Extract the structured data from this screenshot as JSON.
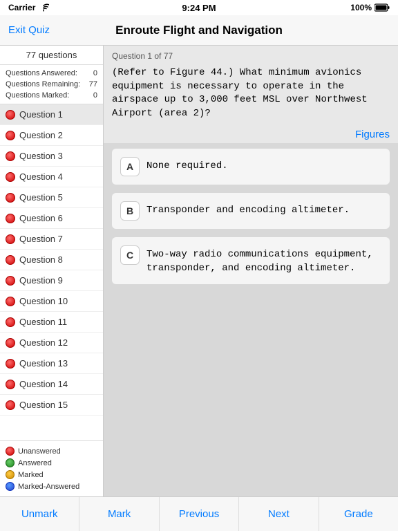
{
  "statusBar": {
    "carrier": "Carrier",
    "time": "9:24 PM",
    "battery": "100%"
  },
  "header": {
    "exitLabel": "Exit Quiz",
    "title": "Enroute Flight and Navigation"
  },
  "sidebar": {
    "countLabel": "77 questions",
    "stats": [
      {
        "label": "Questions Answered:",
        "value": "0"
      },
      {
        "label": "Questions Remaining:",
        "value": "77"
      },
      {
        "label": "Questions Marked:",
        "value": "0"
      }
    ],
    "questions": [
      {
        "id": 1,
        "label": "Question 1",
        "status": "unanswered",
        "active": true
      },
      {
        "id": 2,
        "label": "Question 2",
        "status": "unanswered",
        "active": false
      },
      {
        "id": 3,
        "label": "Question 3",
        "status": "unanswered",
        "active": false
      },
      {
        "id": 4,
        "label": "Question 4",
        "status": "unanswered",
        "active": false
      },
      {
        "id": 5,
        "label": "Question 5",
        "status": "unanswered",
        "active": false
      },
      {
        "id": 6,
        "label": "Question 6",
        "status": "unanswered",
        "active": false
      },
      {
        "id": 7,
        "label": "Question 7",
        "status": "unanswered",
        "active": false
      },
      {
        "id": 8,
        "label": "Question 8",
        "status": "unanswered",
        "active": false
      },
      {
        "id": 9,
        "label": "Question 9",
        "status": "unanswered",
        "active": false
      },
      {
        "id": 10,
        "label": "Question 10",
        "status": "unanswered",
        "active": false
      },
      {
        "id": 11,
        "label": "Question 11",
        "status": "unanswered",
        "active": false
      },
      {
        "id": 12,
        "label": "Question 12",
        "status": "unanswered",
        "active": false
      },
      {
        "id": 13,
        "label": "Question 13",
        "status": "unanswered",
        "active": false
      },
      {
        "id": 14,
        "label": "Question 14",
        "status": "unanswered",
        "active": false
      },
      {
        "id": 15,
        "label": "Question 15",
        "status": "unanswered",
        "active": false
      }
    ],
    "legend": [
      {
        "label": "Unanswered",
        "status": "unanswered"
      },
      {
        "label": "Answered",
        "status": "answered"
      },
      {
        "label": "Marked",
        "status": "marked"
      },
      {
        "label": "Marked-Answered",
        "status": "marked-answered"
      }
    ]
  },
  "question": {
    "counter": "Question 1 of 77",
    "text": "(Refer to Figure 44.) What minimum avionics\nequipment is necessary to operate in the airspace up\nto 3,000 feet MSL over Northwest Airport (area 2)?",
    "figuresLabel": "Figures",
    "answers": [
      {
        "letter": "A",
        "text": "None required."
      },
      {
        "letter": "B",
        "text": "Transponder and encoding altimeter."
      },
      {
        "letter": "C",
        "text": "Two-way radio communications equipment,\ntransponder, and encoding altimeter."
      }
    ]
  },
  "toolbar": {
    "buttons": [
      {
        "label": "Unmark",
        "name": "unmark-button"
      },
      {
        "label": "Mark",
        "name": "mark-button"
      },
      {
        "label": "Previous",
        "name": "previous-button"
      },
      {
        "label": "Next",
        "name": "next-button"
      },
      {
        "label": "Grade",
        "name": "grade-button"
      }
    ]
  }
}
